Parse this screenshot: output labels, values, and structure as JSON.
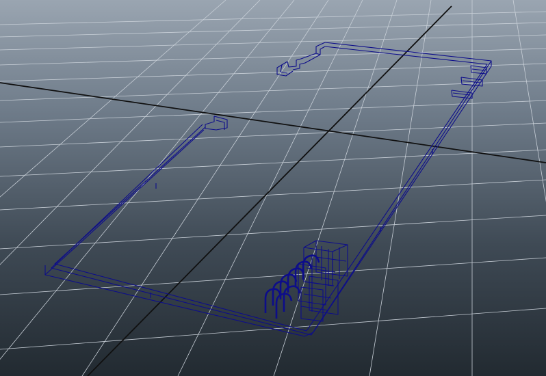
{
  "viewport": {
    "view": "perspective",
    "background_top": "#9aa5b1",
    "background_bottom": "#222a31"
  },
  "grid": {
    "visible": true,
    "line_color": "#c9d0d8",
    "axis_color": "#101010"
  },
  "model": {
    "display": "wireframe",
    "wire_color": "#0d0d8a",
    "parts": [
      "outer-frame",
      "back-upper-handle",
      "back-lower-handle",
      "left-side-clip",
      "right-clip-top",
      "right-clip-middle",
      "right-clip-bottom",
      "arch-stack",
      "box-cluster"
    ]
  }
}
